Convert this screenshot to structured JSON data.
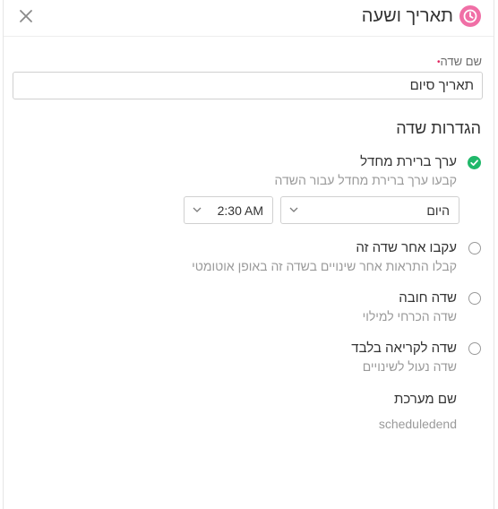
{
  "header": {
    "title": "תאריך ושעה",
    "icon": "clock-icon",
    "icon_color": "#f06fa6",
    "close_icon": "close-icon"
  },
  "field": {
    "label": "שם שדה",
    "required_marker": "•",
    "required_color": "#e0245e",
    "value": "תאריך סיום"
  },
  "settings": {
    "title": "הגדרות שדה",
    "options": [
      {
        "title": "ערך ברירת מחדל",
        "description": "קבעו ערך ברירת מחדל עבור השדה",
        "checked": true,
        "check_color": "#20b86a"
      },
      {
        "title": "עקבו אחר שדה זה",
        "description": "קבלו התראות אחר שינויים בשדה זה באופן אוטומטי",
        "checked": false
      },
      {
        "title": "שדה חובה",
        "description": "שדה הכרחי למילוי",
        "checked": false
      },
      {
        "title": "שדה לקריאה בלבד",
        "description": "שדה נעול לשינויים",
        "checked": false
      }
    ],
    "default_date": "היום",
    "default_time": "2:30 AM"
  },
  "system_name": {
    "label": "שם מערכת",
    "value": "scheduledend"
  }
}
